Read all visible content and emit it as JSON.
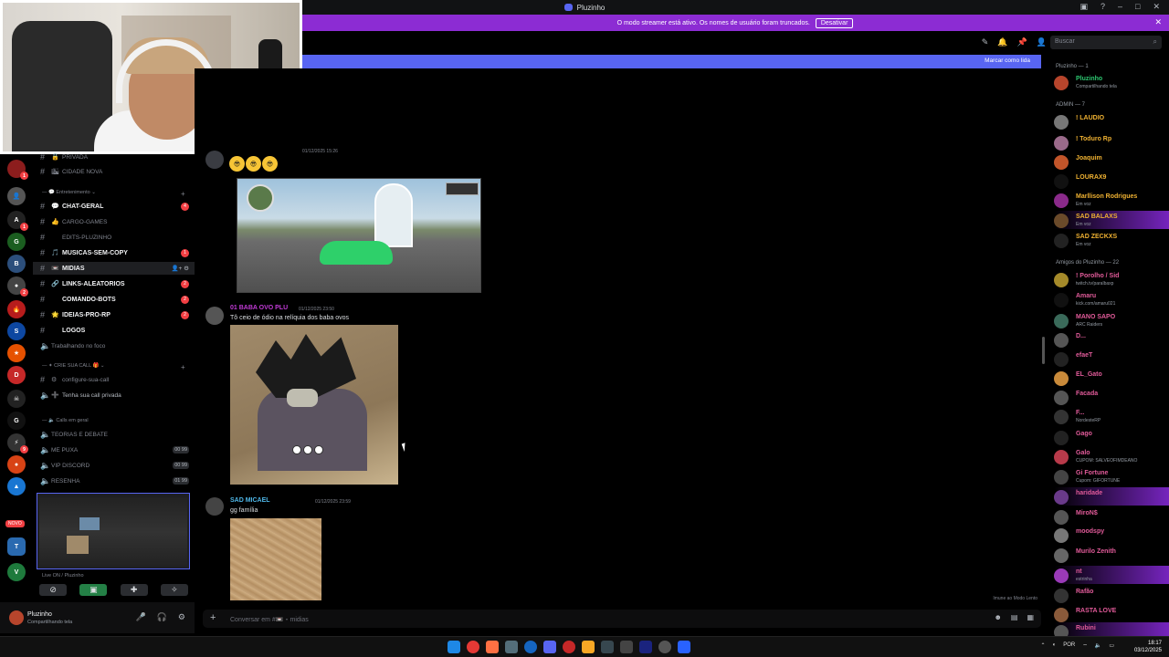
{
  "window": {
    "title": "Pluzinho"
  },
  "banner": {
    "text": "O modo streamer está ativo. Os nomes de usuário foram truncados.",
    "button": "Desativar"
  },
  "search": {
    "placeholder": "Buscar"
  },
  "new_messages": {
    "label": "Marcar como lida"
  },
  "channels": {
    "top": [
      {
        "emoji": "🔒",
        "name": "privada",
        "bold": false
      },
      {
        "emoji": "🏙",
        "name": "cidade nova",
        "bold": false
      }
    ],
    "cat_entretenimento": "Entretenimento",
    "entretenimento": [
      {
        "emoji": "💬",
        "name": "chat-geral",
        "bold": true,
        "badge": "4"
      },
      {
        "emoji": "👍",
        "name": "cargo-games",
        "bold": false
      },
      {
        "emoji": "",
        "name": "edits-pluzinho",
        "bold": false
      },
      {
        "emoji": "🎵",
        "name": "musicas-sem-copy",
        "bold": true,
        "badge": "1"
      },
      {
        "emoji": "📼",
        "name": "midias",
        "bold": true,
        "active": true
      },
      {
        "emoji": "🔗",
        "name": "links-aleatorios",
        "bold": true,
        "badge": "2"
      },
      {
        "emoji": "",
        "name": "comando-bots",
        "bold": true,
        "badge": "2"
      },
      {
        "emoji": "🌟",
        "name": "ideias-pro-rp",
        "bold": true,
        "badge": "2"
      },
      {
        "emoji": "",
        "name": "logos",
        "bold": true
      }
    ],
    "voice_focus": "Trabalhando no foco",
    "cat_crie": "CRIE SUA CALL",
    "crie": [
      {
        "name": "configure-sua-call"
      },
      {
        "name": "Tenha sua call privada"
      }
    ],
    "cat_calls": "Calls em geral",
    "calls": [
      {
        "name": "TEORIAS E DEBATE",
        "count": ""
      },
      {
        "name": "ME PUXA",
        "count": "00 99"
      },
      {
        "name": "VIP DISCORD",
        "count": "00 99"
      },
      {
        "name": "RESENHA",
        "count": "01 99"
      }
    ],
    "live_label": "Live ON / Pluzinho"
  },
  "rail": {
    "novo": "NOVO"
  },
  "user_panel": {
    "name": "Pluzinho",
    "status": "Compartilhando tela"
  },
  "messages": [
    {
      "author": "",
      "timestamp": "01/12/2025 15:26",
      "text": ""
    },
    {
      "author": "01 BABA OVO PLU",
      "timestamp": "01/12/2025 23:50",
      "text": "Tô ceio de ódio na relíquia dos baba ovos"
    },
    {
      "author": "SAD MICAEL",
      "timestamp": "01/12/2025 23:59",
      "text": "gg família"
    }
  ],
  "slowmode": "Imune ao Modo Lento",
  "composer": {
    "placeholder": "Conversar em #📼・midias"
  },
  "members": {
    "owner_group": "Pluzinho — 1",
    "owner": {
      "name": "Pluzinho",
      "sub": "Compartilhando tela",
      "color": "#2dc770"
    },
    "admin_group": "ADMIN — 7",
    "admins": [
      {
        "name": "! LAUDIO",
        "sub": "",
        "color": "#f0b232"
      },
      {
        "name": "! Toduro Rp",
        "sub": "",
        "color": "#f0b232"
      },
      {
        "name": "Joaquim",
        "sub": "",
        "color": "#f0b232"
      },
      {
        "name": "LOURAX9",
        "sub": "",
        "color": "#f0b232"
      },
      {
        "name": "Marllison Rodrigues",
        "sub": "Em voz",
        "color": "#f0b232"
      },
      {
        "name": "SAD BALAXS",
        "sub": "Em voz",
        "color": "#f0b232"
      },
      {
        "name": "SAD ZECKXS",
        "sub": "Em voz",
        "color": "#f0b232"
      }
    ],
    "friends_group": "Amigos do Pluzinho — 22",
    "friends": [
      {
        "name": "! Porolho / Sid",
        "sub": "twitch.tv/paralbaxp",
        "color": "#e25b9a"
      },
      {
        "name": "Amaru",
        "sub": "kick.com/amaru021",
        "color": "#e25b9a"
      },
      {
        "name": "MANO SAPO",
        "sub": "ARC Raiders",
        "color": "#e25b9a"
      },
      {
        "name": "D...",
        "sub": "",
        "color": "#e25b9a"
      },
      {
        "name": "efaeT",
        "sub": "",
        "color": "#e25b9a"
      },
      {
        "name": "EL_Gato",
        "sub": "",
        "color": "#e25b9a"
      },
      {
        "name": "Facada",
        "sub": "",
        "color": "#e25b9a"
      },
      {
        "name": "F...",
        "sub": "NordesteRP",
        "color": "#e25b9a"
      },
      {
        "name": "Gago",
        "sub": "",
        "color": "#e25b9a"
      },
      {
        "name": "Galo",
        "sub": "CUPOM: SALVEOFIMDEANO",
        "color": "#e25b9a"
      },
      {
        "name": "Gi Fortune",
        "sub": "Cupom: GIFORTUNE",
        "color": "#e25b9a"
      },
      {
        "name": "haridade",
        "sub": "",
        "color": "#e25b9a"
      },
      {
        "name": "MiroN$",
        "sub": "",
        "color": "#e25b9a"
      },
      {
        "name": "moodspy",
        "sub": "",
        "color": "#e25b9a"
      },
      {
        "name": "Murilo Zenith",
        "sub": "",
        "color": "#e25b9a"
      },
      {
        "name": "nt",
        "sub": "estrinha",
        "color": "#e25b9a"
      },
      {
        "name": "Rafão",
        "sub": "",
        "color": "#e25b9a"
      },
      {
        "name": "RASTA LOVE",
        "sub": "",
        "color": "#e25b9a"
      },
      {
        "name": "Rubini",
        "sub": "",
        "color": "#e25b9a"
      }
    ]
  },
  "taskbar": {
    "lang": "POR",
    "time": "18:17",
    "date": "03/12/2025"
  }
}
